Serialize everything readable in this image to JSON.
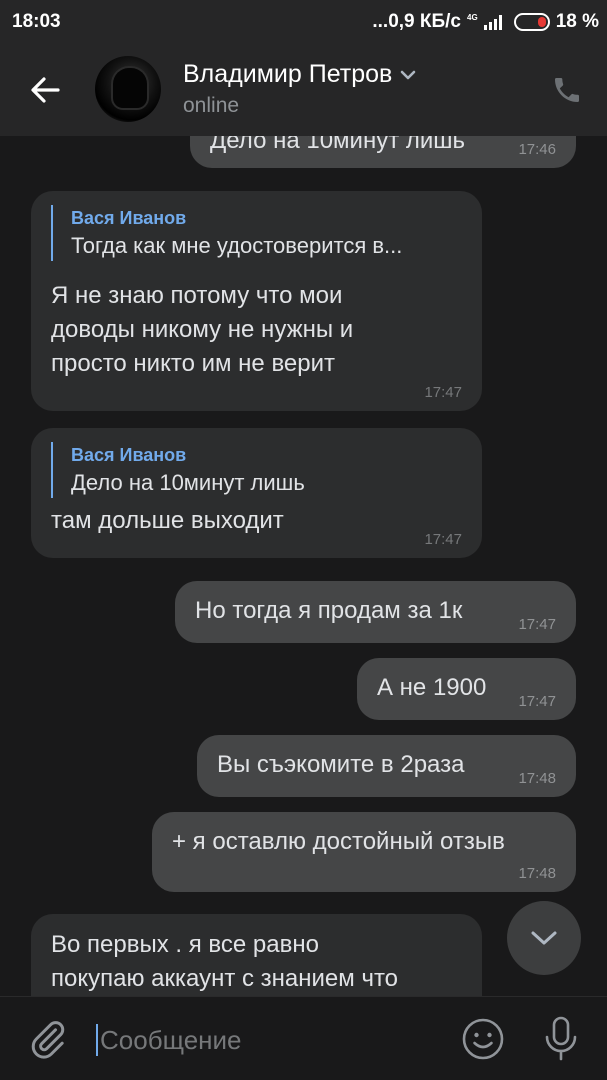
{
  "status_bar": {
    "time": "18:03",
    "network_speed": "...0,9 КБ/с",
    "network_type": "4G",
    "battery": "18 %"
  },
  "header": {
    "name": "Владимир Петров",
    "status": "online"
  },
  "messages": [
    {
      "type": "out",
      "text": "Дело на 10минут лишь",
      "time": "17:46"
    },
    {
      "type": "in",
      "reply_name": "Вася Иванов",
      "reply_text": "Тогда как мне удостоверится в...",
      "text": "Я не знаю потому что мои\nдоводы никому не нужны и\nпросто никто им не верит",
      "time": "17:47"
    },
    {
      "type": "in",
      "reply_name": "Вася Иванов",
      "reply_text": "Дело на 10минут лишь",
      "text": "там дольше выходит",
      "time": "17:47"
    },
    {
      "type": "out",
      "text": "Но тогда я продам за 1к",
      "time": "17:47"
    },
    {
      "type": "out",
      "text": "А не 1900",
      "time": "17:47"
    },
    {
      "type": "out",
      "text": "Вы съэкомите в 2раза",
      "time": "17:48"
    },
    {
      "type": "out",
      "text": "+ я оставлю достойный отзыв",
      "time": "17:48"
    },
    {
      "type": "in",
      "text": "Во первых . я все равно\nпокупаю аккаунт с знанием что"
    }
  ],
  "composer": {
    "placeholder": "Сообщение"
  },
  "icons": {
    "back": "arrow-left-icon",
    "call": "phone-icon",
    "chevron": "chevron-down-icon",
    "attach": "paperclip-icon",
    "emoji": "smiley-icon",
    "mic": "microphone-icon",
    "scroll": "chevron-down-icon"
  },
  "colors": {
    "accent": "#71aaeb",
    "background": "#19191a",
    "bar": "#262627",
    "incoming_bubble": "#2c2d2e",
    "outgoing_bubble": "#454647"
  }
}
